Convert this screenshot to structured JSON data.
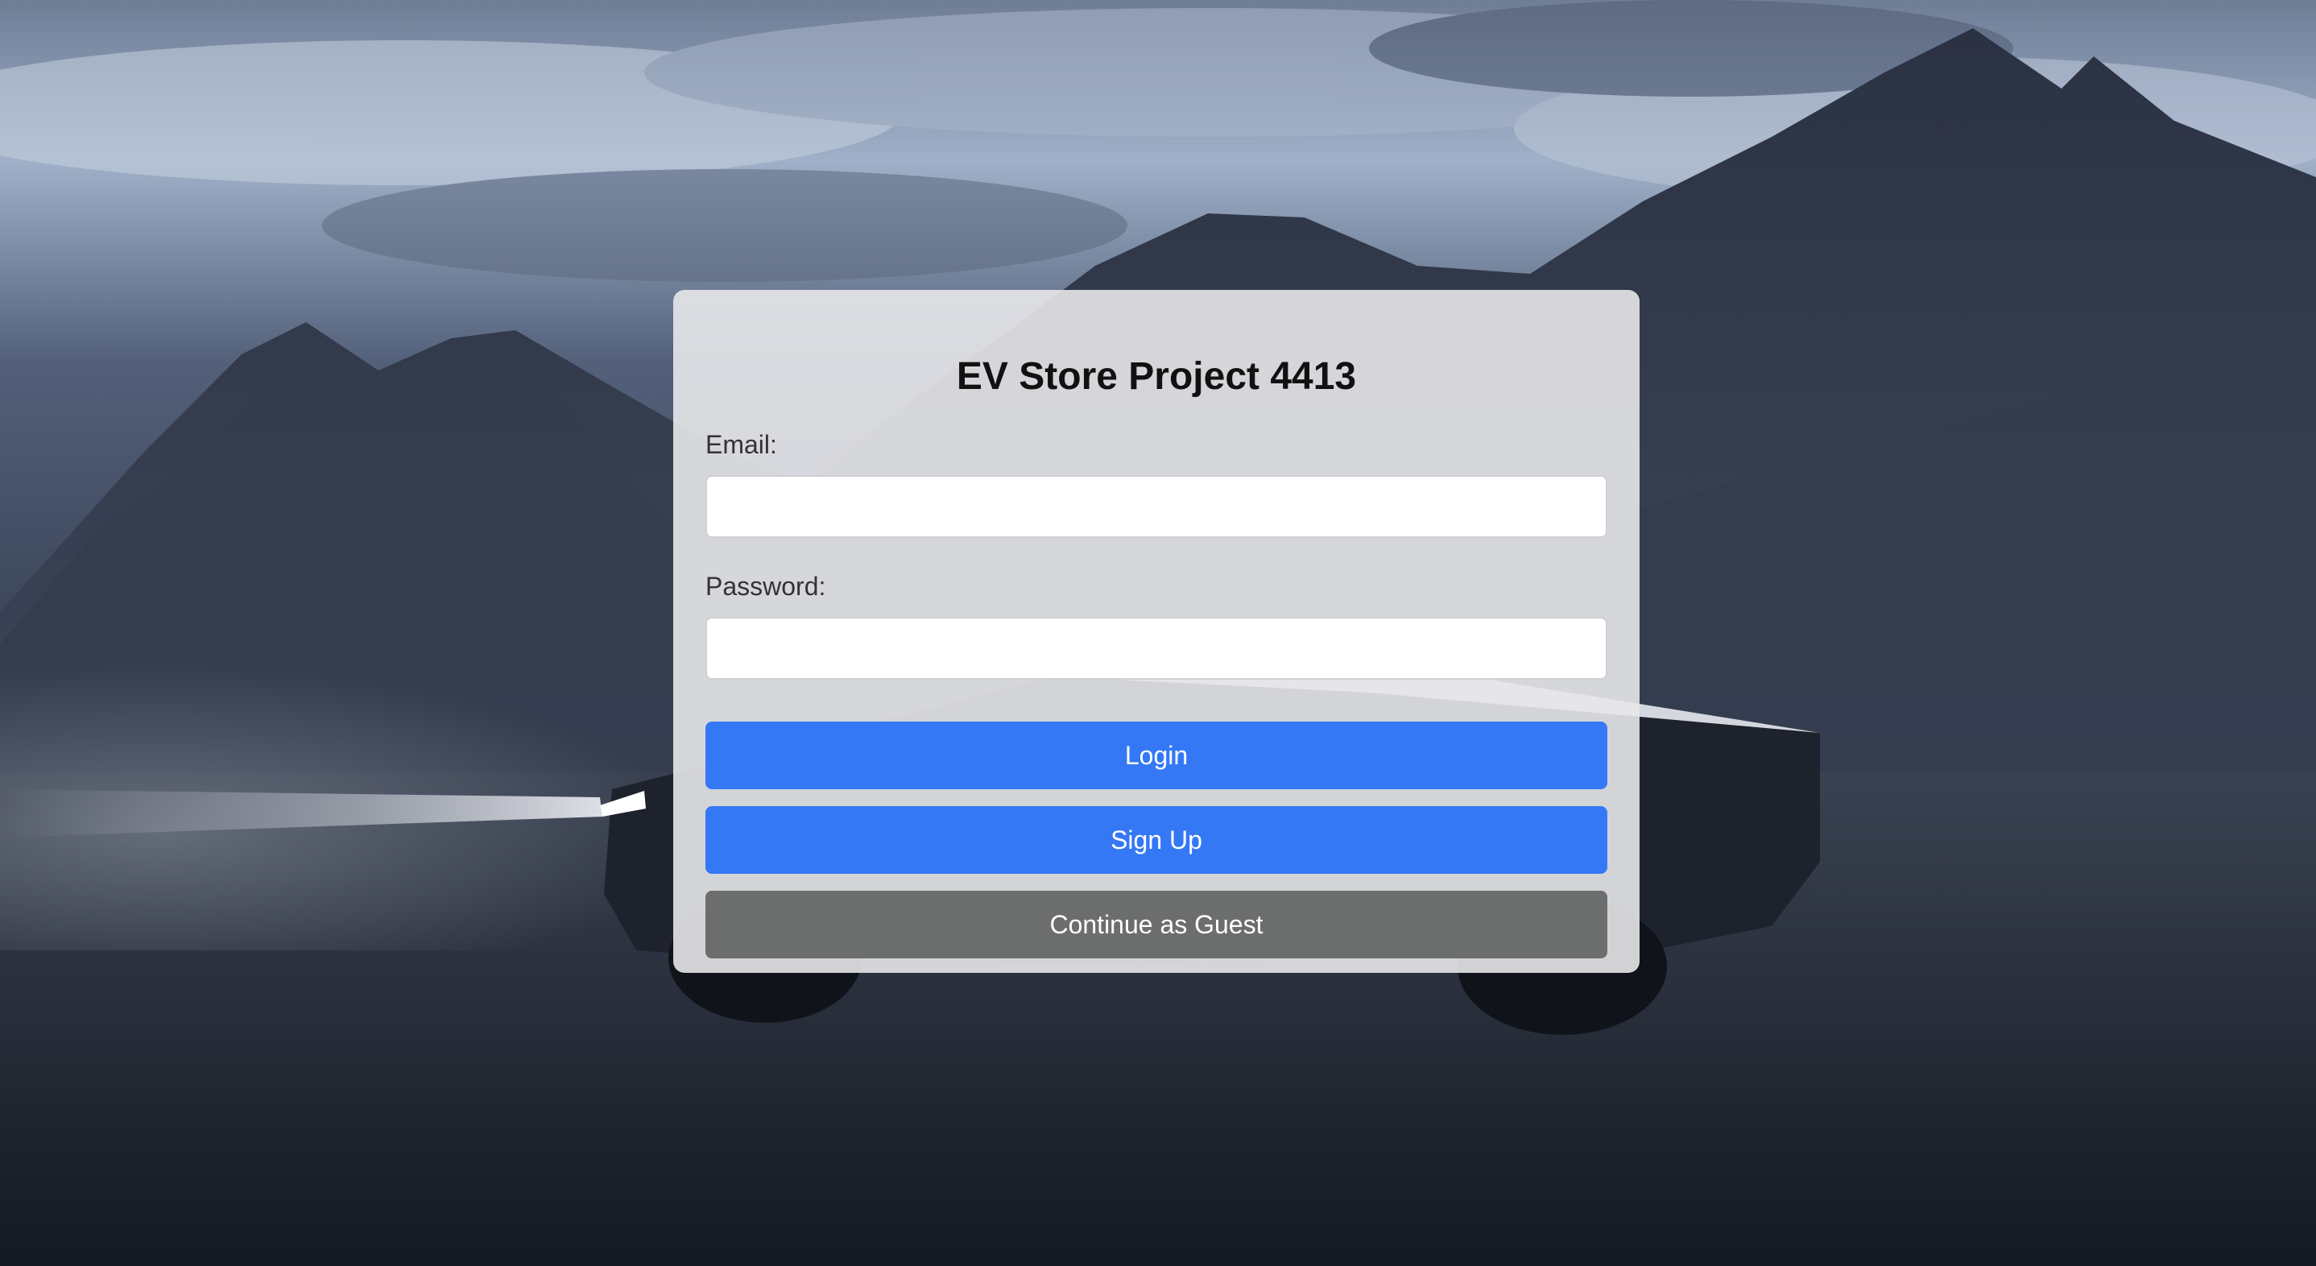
{
  "login_card": {
    "title": "EV Store Project 4413",
    "email_label": "Email:",
    "email_value": "",
    "password_label": "Password:",
    "password_value": "",
    "login_label": "Login",
    "signup_label": "Sign Up",
    "guest_label": "Continue as Guest"
  },
  "colors": {
    "primary_button": "#3478f6",
    "secondary_button": "#6c6d6d",
    "card_background": "#e8e8ea"
  },
  "background": {
    "icon": "mountain-landscape-with-cybertruck"
  }
}
